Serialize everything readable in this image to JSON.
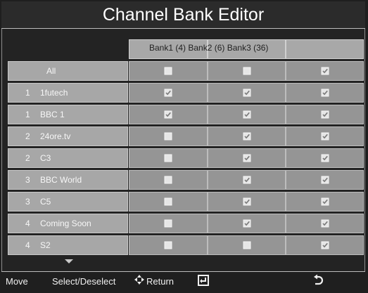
{
  "title": "Channel Bank Editor",
  "header": {
    "banks_label": "Bank1 (4) Bank2 (6) Bank3 (36)"
  },
  "rows": [
    {
      "num": "",
      "name": "All",
      "b1": false,
      "b2": false,
      "b3": true
    },
    {
      "num": "1",
      "name": "1futech",
      "b1": true,
      "b2": true,
      "b3": true
    },
    {
      "num": "1",
      "name": "BBC 1",
      "b1": true,
      "b2": true,
      "b3": true
    },
    {
      "num": "2",
      "name": "24ore.tv",
      "b1": false,
      "b2": true,
      "b3": true
    },
    {
      "num": "2",
      "name": "C3",
      "b1": false,
      "b2": true,
      "b3": true
    },
    {
      "num": "3",
      "name": "BBC World",
      "b1": false,
      "b2": true,
      "b3": true
    },
    {
      "num": "3",
      "name": "C5",
      "b1": false,
      "b2": true,
      "b3": true
    },
    {
      "num": "4",
      "name": "Coming Soon",
      "b1": false,
      "b2": true,
      "b3": true
    },
    {
      "num": "4",
      "name": "S2",
      "b1": false,
      "b2": false,
      "b3": true
    }
  ],
  "footer": {
    "move": "Move",
    "select": "Select/Deselect",
    "return": "Return"
  },
  "icons": {
    "move": "move-arrows-icon",
    "enter": "enter-icon",
    "return": "return-icon",
    "scroll": "scroll-down-icon"
  },
  "colors": {
    "background": "#232323",
    "cell": "#959595",
    "channel_cell": "#a7a7a7",
    "checkbox": "#e6e6e6"
  }
}
